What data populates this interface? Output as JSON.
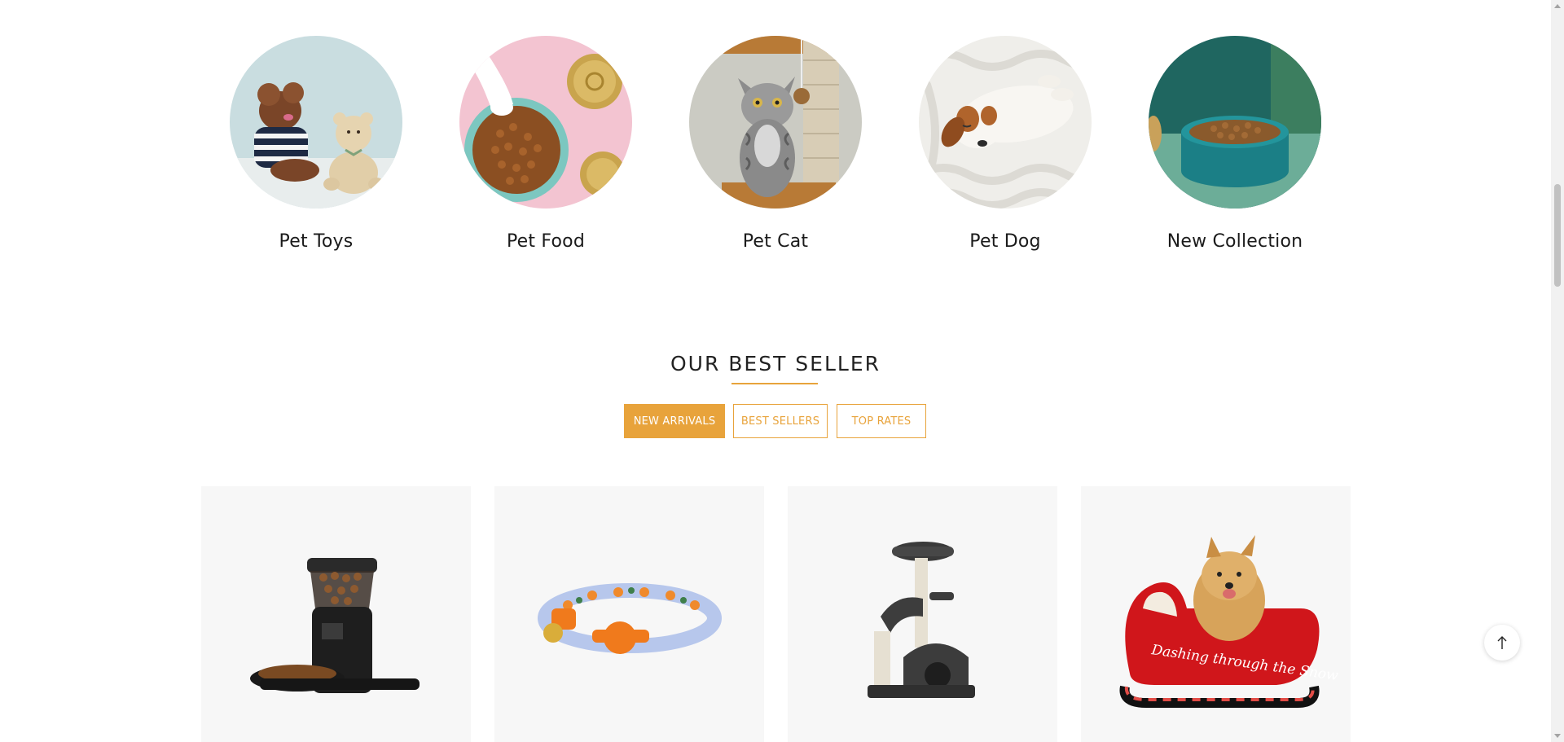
{
  "categories": [
    {
      "label": "Pet Toys",
      "image": "poodle-and-teddy-bear-photo"
    },
    {
      "label": "Pet Food",
      "image": "kibble-bowl-on-pink-photo"
    },
    {
      "label": "Pet Cat",
      "image": "grey-tabby-cat-photo"
    },
    {
      "label": "Pet Dog",
      "image": "sleeping-puppy-on-knit-blanket-photo"
    },
    {
      "label": "New Collection",
      "image": "teal-food-bowl-photo"
    }
  ],
  "best_seller": {
    "title": "OUR BEST SELLER",
    "accent_color": "#e8a33b",
    "tabs": [
      {
        "label": "NEW ARRIVALS",
        "active": true
      },
      {
        "label": "BEST SELLERS",
        "active": false
      },
      {
        "label": "TOP RATES",
        "active": false
      }
    ]
  },
  "products": [
    {
      "image": "automatic-pet-feeder-photo"
    },
    {
      "image": "patterned-cat-collar-photo"
    },
    {
      "image": "cat-tree-tower-photo"
    },
    {
      "image": "yorkie-in-red-sleigh-bed-photo",
      "image_text": "Dashing through the Snow"
    }
  ],
  "scroll_top": {
    "icon": "arrow-up-icon"
  }
}
